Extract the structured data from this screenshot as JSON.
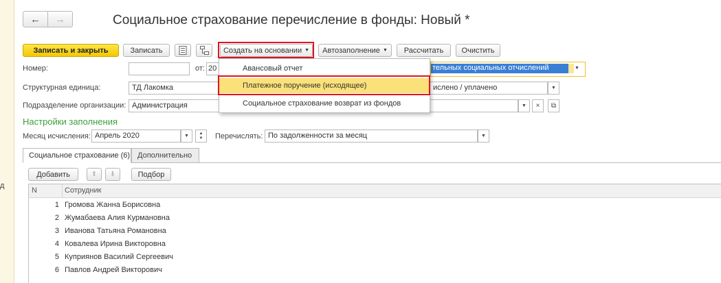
{
  "window": {
    "title": "Социальное страхование перечисление в фонды: Новый *",
    "left_fragment": "д"
  },
  "nav": {
    "back": "←",
    "forward": "→"
  },
  "toolbar": {
    "save_close": "Записать и закрыть",
    "save": "Записать",
    "create_based_on": "Создать на основании",
    "autofill": "Автозаполнение",
    "calculate": "Рассчитать",
    "clear": "Очистить"
  },
  "form": {
    "number_label": "Номер:",
    "number_value": "",
    "from_label": "от:",
    "from_value": "20",
    "type_value": "тельных социальных отчислений",
    "unit_label": "Структурная единица:",
    "unit_value": "ТД Лакомка",
    "status_value": "ислено / уплачено",
    "subdivision_label": "Подразделение организации:",
    "subdivision_value": "Администрация"
  },
  "fill_settings": {
    "title": "Настройки заполнения",
    "month_label": "Месяц исчисления:",
    "month_value": "Апрель 2020",
    "transfer_label": "Перечислять:",
    "transfer_value": "По задолженности за месяц"
  },
  "tabs": [
    {
      "label": "Социальное страхование (6)"
    },
    {
      "label": "Дополнительно"
    }
  ],
  "table_toolbar": {
    "add": "Добавить",
    "select": "Подбор"
  },
  "table": {
    "columns": [
      "N",
      "Сотрудник"
    ],
    "rows": [
      {
        "n": "1",
        "name": "Громова Жанна Борисовна"
      },
      {
        "n": "2",
        "name": "Жумабаева Алия Курмановна"
      },
      {
        "n": "3",
        "name": "Иванова Татьяна Романовна"
      },
      {
        "n": "4",
        "name": "Ковалева Ирина Викторовна"
      },
      {
        "n": "5",
        "name": "Куприянов Василий Сергеевич"
      },
      {
        "n": "6",
        "name": "Павлов Андрей Викторович"
      }
    ]
  },
  "dropdown": {
    "items": [
      {
        "label": "Авансовый отчет"
      },
      {
        "label": "Платежное поручение (исходящее)"
      },
      {
        "label": "Социальное страхование возврат из фондов"
      }
    ]
  },
  "colors": {
    "primary_button": "#f4c800",
    "highlight_box": "#e0141e",
    "section_title": "#3b9e3b",
    "menu_hover": "#fbe17a"
  }
}
